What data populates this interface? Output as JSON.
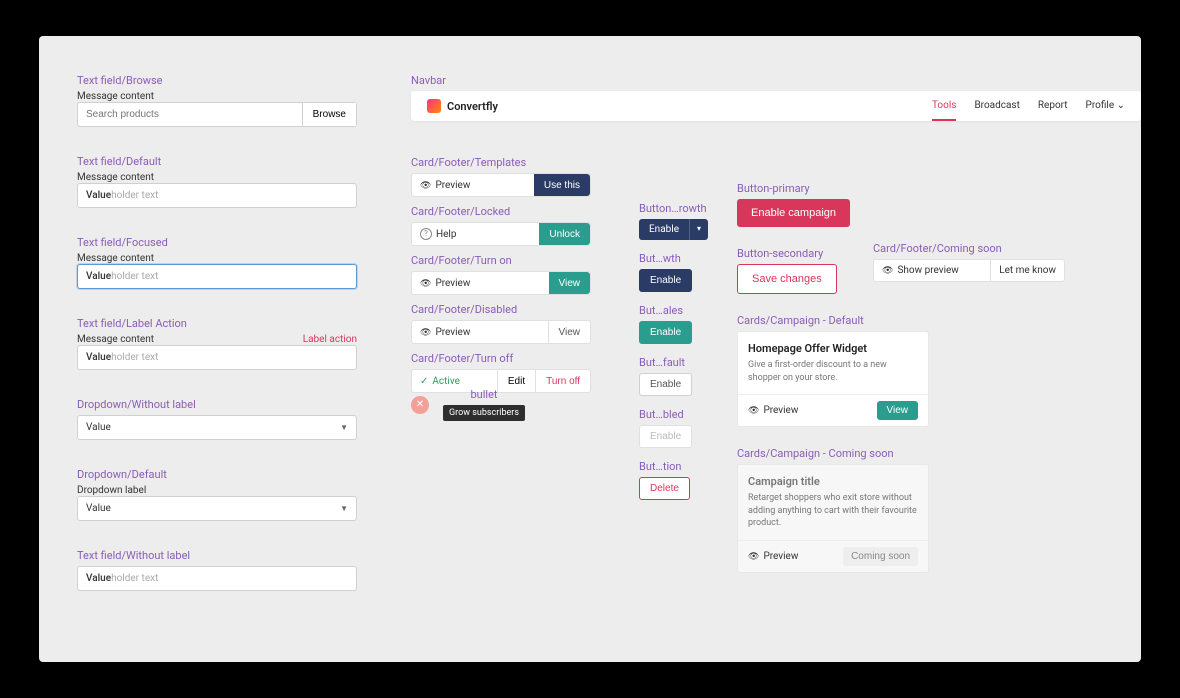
{
  "textfield": {
    "browse": {
      "section": "Text field/Browse",
      "label": "Message content",
      "placeholder": "Search products",
      "button": "Browse"
    },
    "default": {
      "section": "Text field/Default",
      "label": "Message content",
      "value_prefix": "Value",
      "value_rest": "holder text"
    },
    "focused": {
      "section": "Text field/Focused",
      "label": "Message content",
      "value_prefix": "Value",
      "value_rest": "holder text"
    },
    "labelaction": {
      "section": "Text field/Label Action",
      "label": "Message content",
      "action": "Label action",
      "value_prefix": "Value",
      "value_rest": "holder text"
    },
    "nolabel": {
      "section": "Text field/Without label",
      "value_prefix": "Value",
      "value_rest": "holder text"
    }
  },
  "dropdown": {
    "nolabel": {
      "section": "Dropdown/Without label",
      "value": "Value"
    },
    "default": {
      "section": "Dropdown/Default",
      "label": "Dropdown label",
      "value": "Value"
    }
  },
  "navbar": {
    "section": "Navbar",
    "brand": "Convertfly",
    "items": [
      "Tools",
      "Broadcast",
      "Report",
      "Profile ⌄"
    ]
  },
  "cardfooter": {
    "templates": {
      "section": "Card/Footer/Templates",
      "status": "Preview",
      "button": "Use this"
    },
    "locked": {
      "section": "Card/Footer/Locked",
      "status": "Help",
      "button": "Unlock"
    },
    "turnon": {
      "section": "Card/Footer/Turn on",
      "status": "Preview",
      "button": "View"
    },
    "disabled": {
      "section": "Card/Footer/Disabled",
      "status": "Preview",
      "button": "View"
    },
    "turnoff": {
      "section": "Card/Footer/Turn off",
      "status": "Active",
      "mid": "Edit",
      "button": "Turn off"
    },
    "comingsoon": {
      "section": "Card/Footer/Coming soon",
      "status": "Show preview",
      "button": "Let me know"
    }
  },
  "bullet": {
    "section": "bullet",
    "tooltip": "Grow subscribers"
  },
  "solo_buttons": {
    "growth": {
      "section": "Button…rowth",
      "label": "Enable"
    },
    "growth2": {
      "section": "But…wth",
      "label": "Enable"
    },
    "sales": {
      "section": "But…ales",
      "label": "Enable"
    },
    "default": {
      "section": "But…fault",
      "label": "Enable"
    },
    "disabled": {
      "section": "But…bled",
      "label": "Enable"
    },
    "destructive": {
      "section": "But…tion",
      "label": "Delete"
    }
  },
  "button_primary": {
    "section": "Button-primary",
    "label": "Enable campaign"
  },
  "button_secondary": {
    "section": "Button-secondary",
    "label": "Save changes"
  },
  "campaign_default": {
    "section": "Cards/Campaign - Default",
    "title": "Homepage Offer Widget",
    "desc": "Give a first-order discount to a new shopper on your store.",
    "preview": "Preview",
    "button": "View"
  },
  "campaign_coming": {
    "section": "Cards/Campaign - Coming soon",
    "title": "Campaign title",
    "desc": "Retarget shoppers who exit store without adding anything to cart with their favourite product.",
    "preview": "Preview",
    "button": "Coming soon"
  }
}
